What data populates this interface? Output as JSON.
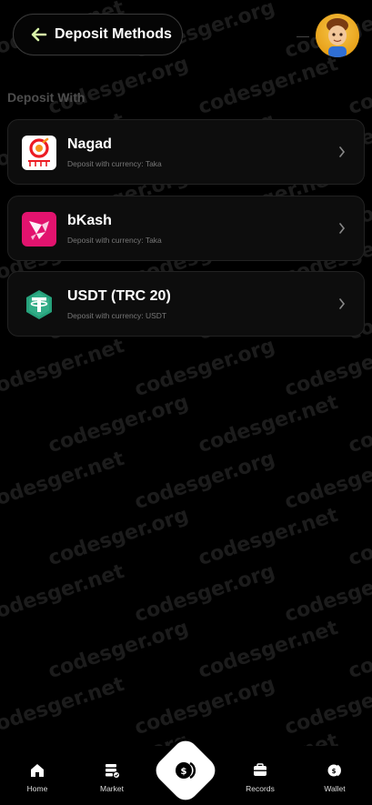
{
  "header": {
    "title": "Deposit Methods"
  },
  "section_title": "Deposit With",
  "methods": [
    {
      "name": "Nagad",
      "subtitle": "Deposit with currency: Taka",
      "icon": "nagad-logo-icon"
    },
    {
      "name": "bKash",
      "subtitle": "Deposit with currency: Taka",
      "icon": "bkash-logo-icon"
    },
    {
      "name": "USDT (TRC 20)",
      "subtitle": "Deposit with currency: USDT",
      "icon": "tether-logo-icon"
    }
  ],
  "nav": {
    "home": "Home",
    "market": "Market",
    "records": "Records",
    "wallet": "Wallet"
  },
  "colors": {
    "background": "#000000",
    "card": "#0d0d0d",
    "section_title": "#4d4d4d",
    "bkash_pink": "#e2136e",
    "nagad_orange": "#ec1c24",
    "tether_teal": "#26a17b"
  }
}
